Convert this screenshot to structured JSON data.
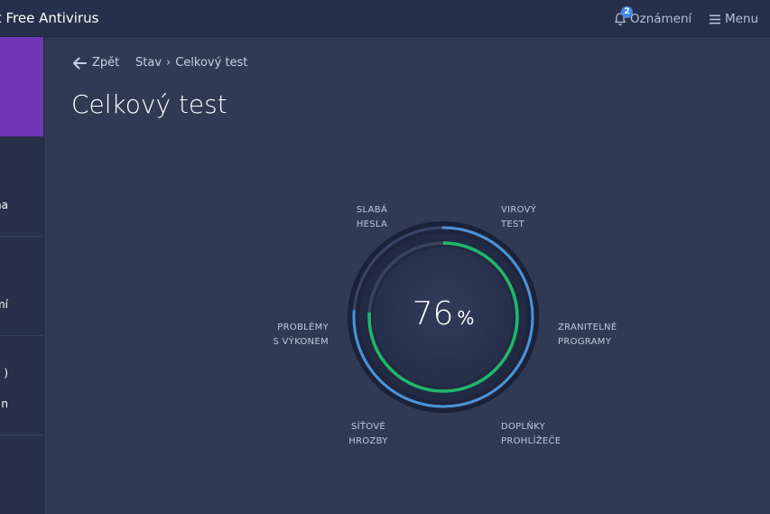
{
  "header": {
    "app_title": "st Free Antivirus",
    "notifications_label": "Oznámení",
    "notifications_count": "2",
    "menu_label": "Menu"
  },
  "sidebar": {
    "items": [
      {
        "label": "na"
      },
      {
        "label": "mí"
      },
      {
        "label": ")"
      },
      {
        "label": "n"
      }
    ]
  },
  "nav": {
    "back_label": "Zpět",
    "breadcrumb_parent": "Stav",
    "breadcrumb_separator": "›",
    "breadcrumb_current": "Celkový test"
  },
  "page": {
    "title": "Celkový test"
  },
  "gauge": {
    "value": "76",
    "unit": "%",
    "progress": 0.76
  },
  "categories": [
    {
      "id": "weak-passwords",
      "line1": "SLABÁ",
      "line2": "HESLA"
    },
    {
      "id": "virus-test",
      "line1": "VIROVÝ",
      "line2": "TEST"
    },
    {
      "id": "vulnerable-programs",
      "line1": "ZRANITELNÉ",
      "line2": "PROGRAMY"
    },
    {
      "id": "browser-addons",
      "line1": "DOPLŇKY",
      "line2": "PROHLÍŽEČE"
    },
    {
      "id": "network-threats",
      "line1": "SÍŤOVÉ",
      "line2": "HROZBY"
    },
    {
      "id": "performance-issues",
      "line1": "PROBLÉMY",
      "line2": "S VÝKONEM"
    }
  ],
  "colors": {
    "accent_green": "#1fb86a",
    "accent_blue": "#4a93d8",
    "brand_purple": "#7434b8",
    "background": "#303a52"
  }
}
